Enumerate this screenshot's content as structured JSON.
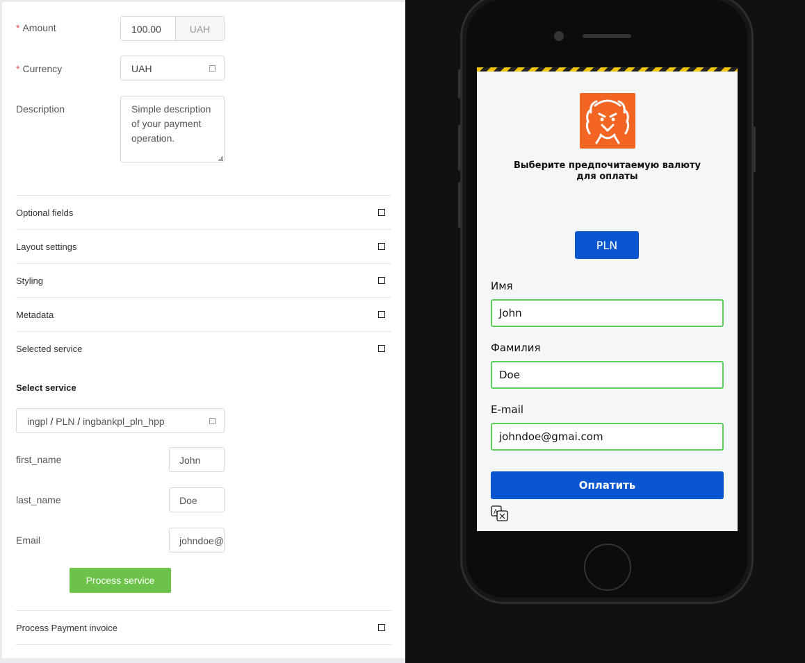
{
  "form": {
    "amount_label": "Amount",
    "amount_value": "100.00",
    "amount_currency": "UAH",
    "currency_label": "Currency",
    "currency_value": "UAH",
    "description_label": "Description",
    "description_value": "Simple description of your payment operation."
  },
  "sections": {
    "optional_fields": "Optional fields",
    "layout_settings": "Layout settings",
    "styling": "Styling",
    "metadata": "Metadata",
    "selected_service": "Selected service",
    "process_payment_invoice": "Process Payment invoice"
  },
  "service": {
    "heading": "Select service",
    "path_part1": "ingpl",
    "path_sep1": "/",
    "path_part2": "PLN",
    "path_sep2": "/",
    "path_part3": "ingbankpl_pln_hpp",
    "first_name_label": "first_name",
    "first_name_value": "John",
    "last_name_label": "last_name",
    "last_name_value": "Doe",
    "email_label": "Email",
    "email_value": "johndoe@gmai.com",
    "process_button": "Process service"
  },
  "phone": {
    "headline": "Выберите предпочитаемую валюту для оплаты",
    "currency_button": "PLN",
    "first_name_label": "Имя",
    "first_name_value": "John",
    "last_name_label": "Фамилия",
    "last_name_value": "Doe",
    "email_label": "E-mail",
    "email_value": "johndoe@gmai.com",
    "pay_button": "Оплатить"
  },
  "colors": {
    "accent_blue": "#0a55d0",
    "success_green": "#6cc24a",
    "brand_orange": "#f26522",
    "valid_border": "#5ccf5c",
    "required_red": "#e5484d"
  }
}
